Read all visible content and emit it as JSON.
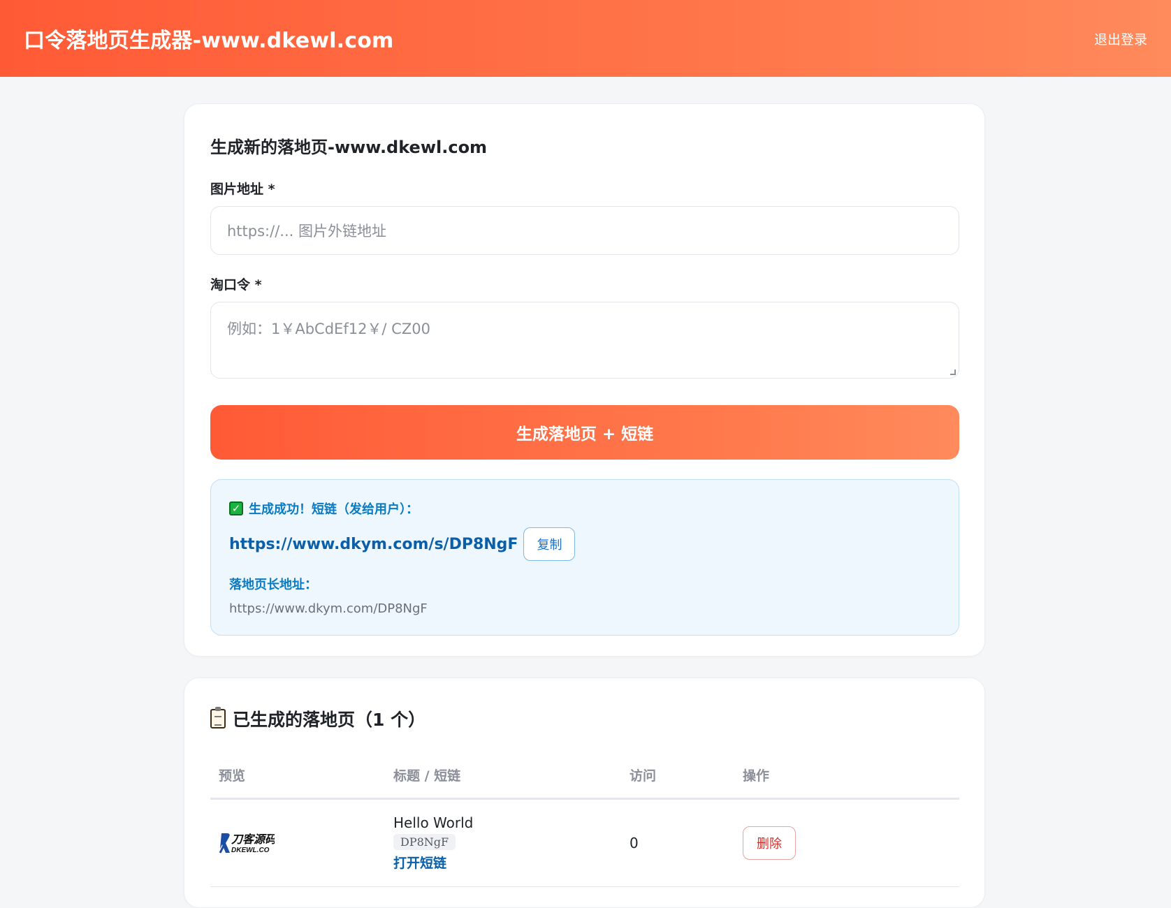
{
  "header": {
    "title": "口令落地页生成器-www.dkewl.com",
    "logout_label": "退出登录"
  },
  "form": {
    "title": "生成新的落地页-www.dkewl.com",
    "image_label": "图片地址 *",
    "image_placeholder": "https://... 图片外链地址",
    "code_label": "淘口令 *",
    "code_placeholder": "例如：1￥AbCdEf12￥/ CZ00",
    "submit_label": "生成落地页 + 短链"
  },
  "result": {
    "success_text": "生成成功！短链（发给用户）：",
    "short_url": "https://www.dkym.com/s/DP8NgF",
    "copy_label": "复制",
    "long_label": "落地页长地址：",
    "long_url": "https://www.dkym.com/DP8NgF"
  },
  "list": {
    "title": "已生成的落地页（1 个）",
    "columns": [
      "预览",
      "标题 / 短链",
      "访问",
      "操作"
    ],
    "rows": [
      {
        "logo_text": "刀客源码",
        "logo_sub": "DKEWL.CO",
        "title": "Hello World",
        "code": "DP8NgF",
        "open_label": "打开短链",
        "visits": "0",
        "delete_label": "删除"
      }
    ]
  },
  "colors": {
    "accent_start": "#ff5a36",
    "accent_end": "#ff8a5c",
    "link_blue": "#0a5fa8",
    "success_bg": "#eff7fe"
  }
}
